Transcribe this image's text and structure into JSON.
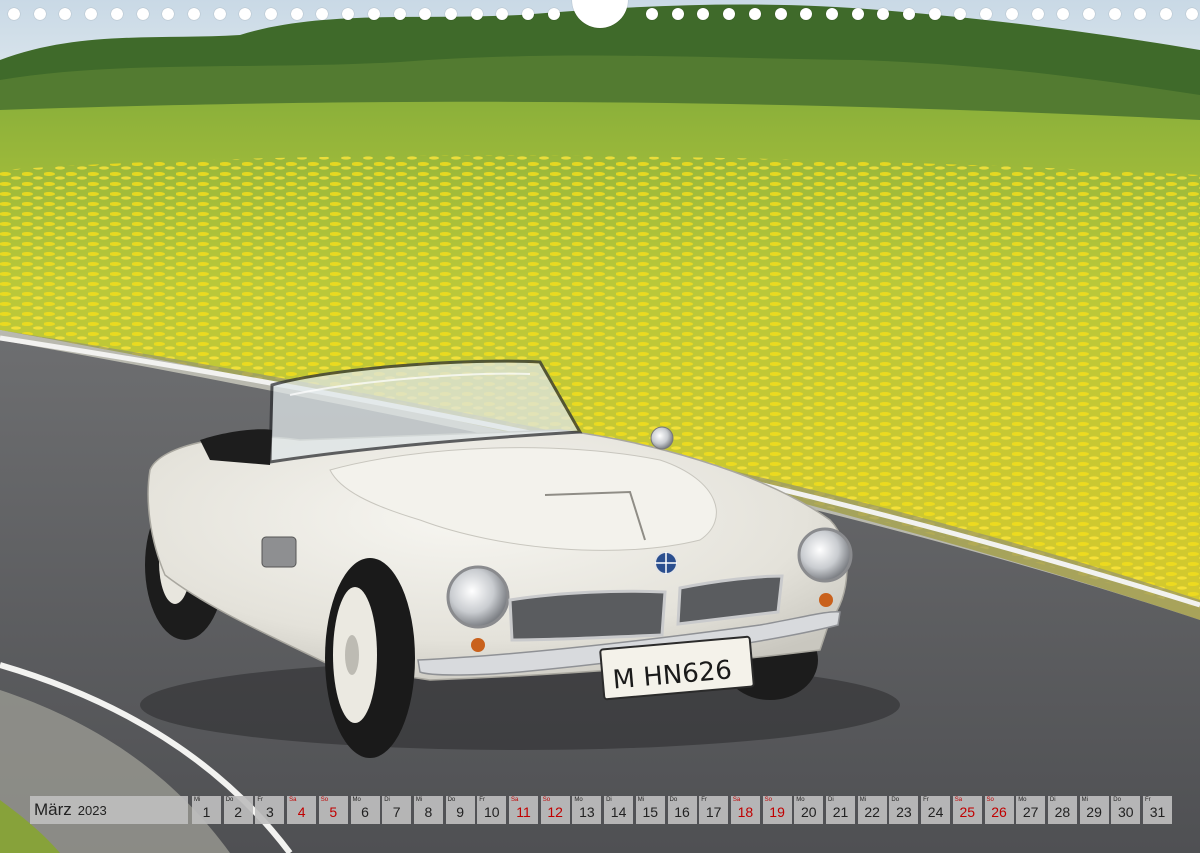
{
  "calendar": {
    "month": "März",
    "year": "2023",
    "days": [
      {
        "num": "1",
        "wd": "Mi",
        "weekend": false
      },
      {
        "num": "2",
        "wd": "Do",
        "weekend": false
      },
      {
        "num": "3",
        "wd": "Fr",
        "weekend": false
      },
      {
        "num": "4",
        "wd": "Sa",
        "weekend": true
      },
      {
        "num": "5",
        "wd": "So",
        "weekend": true
      },
      {
        "num": "6",
        "wd": "Mo",
        "weekend": false
      },
      {
        "num": "7",
        "wd": "Di",
        "weekend": false
      },
      {
        "num": "8",
        "wd": "Mi",
        "weekend": false
      },
      {
        "num": "9",
        "wd": "Do",
        "weekend": false
      },
      {
        "num": "10",
        "wd": "Fr",
        "weekend": false
      },
      {
        "num": "11",
        "wd": "Sa",
        "weekend": true
      },
      {
        "num": "12",
        "wd": "So",
        "weekend": true
      },
      {
        "num": "13",
        "wd": "Mo",
        "weekend": false
      },
      {
        "num": "14",
        "wd": "Di",
        "weekend": false
      },
      {
        "num": "15",
        "wd": "Mi",
        "weekend": false
      },
      {
        "num": "16",
        "wd": "Do",
        "weekend": false
      },
      {
        "num": "17",
        "wd": "Fr",
        "weekend": false
      },
      {
        "num": "18",
        "wd": "Sa",
        "weekend": true
      },
      {
        "num": "19",
        "wd": "So",
        "weekend": true
      },
      {
        "num": "20",
        "wd": "Mo",
        "weekend": false
      },
      {
        "num": "21",
        "wd": "Di",
        "weekend": false
      },
      {
        "num": "22",
        "wd": "Mi",
        "weekend": false
      },
      {
        "num": "23",
        "wd": "Do",
        "weekend": false
      },
      {
        "num": "24",
        "wd": "Fr",
        "weekend": false
      },
      {
        "num": "25",
        "wd": "Sa",
        "weekend": true
      },
      {
        "num": "26",
        "wd": "So",
        "weekend": true
      },
      {
        "num": "27",
        "wd": "Mo",
        "weekend": false
      },
      {
        "num": "28",
        "wd": "Di",
        "weekend": false
      },
      {
        "num": "29",
        "wd": "Mi",
        "weekend": false
      },
      {
        "num": "30",
        "wd": "Do",
        "weekend": false
      },
      {
        "num": "31",
        "wd": "Fr",
        "weekend": false
      }
    ]
  },
  "photo": {
    "plate": "M HN626"
  },
  "colors": {
    "weekend": "#c00000",
    "cell": "#bebebe",
    "car_body": "#ecebe4",
    "field_yellow": "#e7d52a",
    "road": "#5a5b5e"
  }
}
